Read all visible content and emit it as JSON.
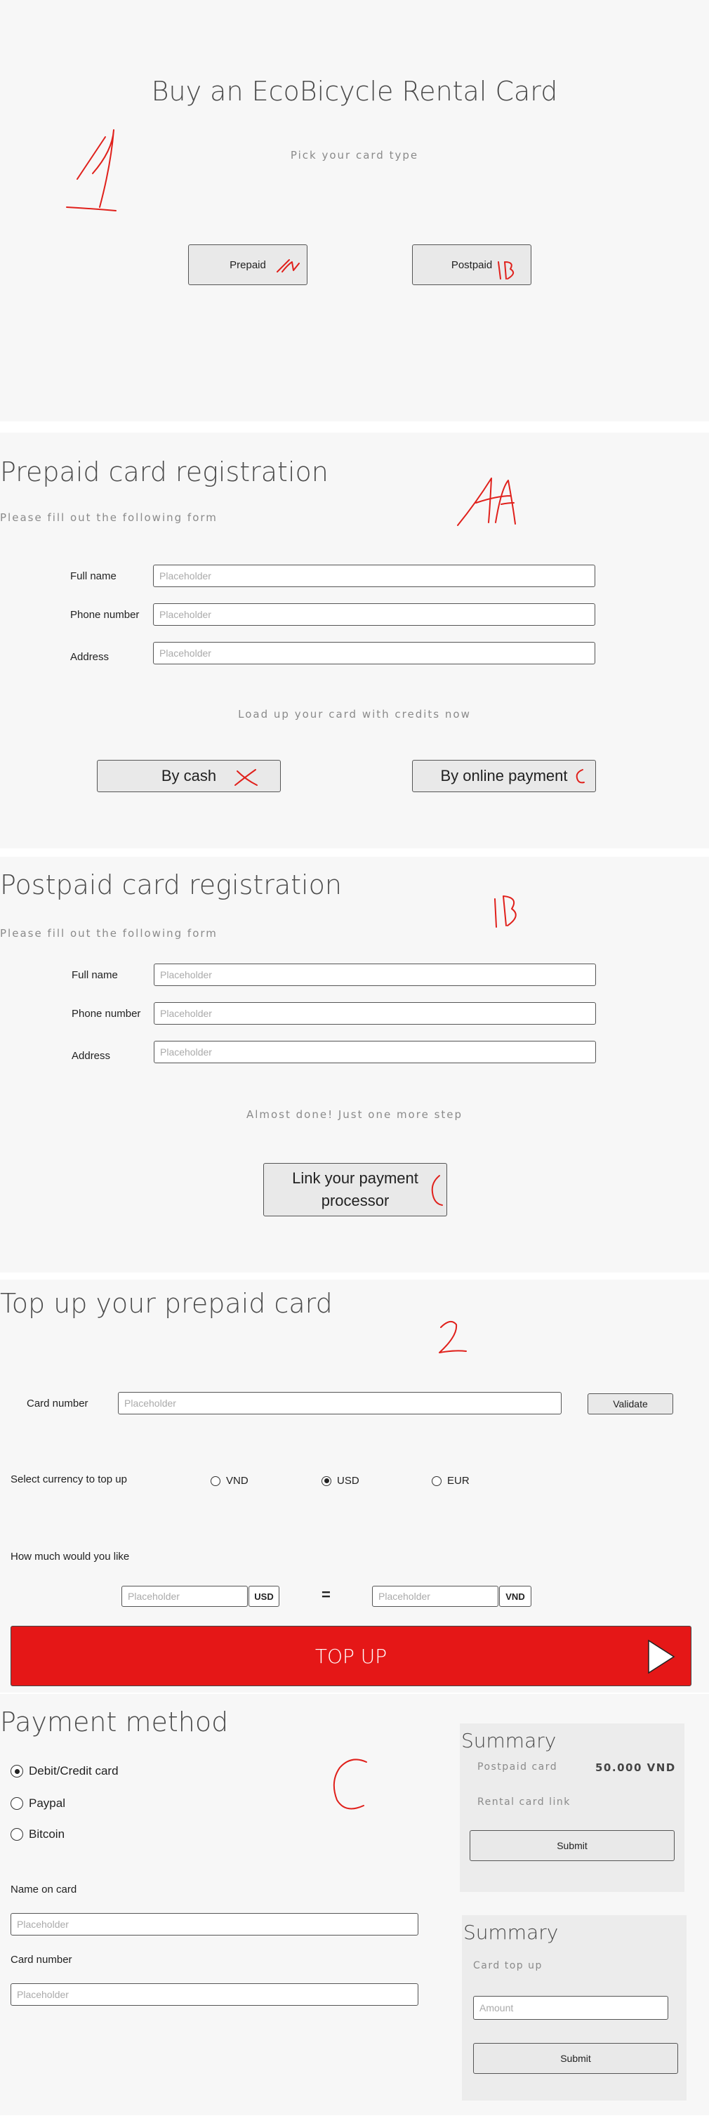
{
  "colors": {
    "panel_bg": "#f7f7f7",
    "accent_red": "#e51717",
    "annotation_red": "#e0201b"
  },
  "pick": {
    "title": "Buy an EcoBicycle Rental Card",
    "subtitle": "Pick your card type",
    "prepaid_label": "Prepaid",
    "postpaid_label": "Postpaid"
  },
  "prepaid": {
    "title": "Prepaid card registration",
    "subtitle": "Please fill out the following form",
    "full_name": "Full name",
    "phone": "Phone number",
    "address": "Address",
    "placeholder": "Placeholder",
    "load_text": "Load up your card with credits now",
    "cash_label": "By cash",
    "online_label": "By online payment"
  },
  "postpaid": {
    "title": "Postpaid card registration",
    "subtitle": "Please fill out the following form",
    "full_name": "Full name",
    "phone": "Phone number",
    "address": "Address",
    "placeholder": "Placeholder",
    "almost_text": "Almost done! Just one more step",
    "link_label_1": "Link your payment",
    "link_label_2": "processor"
  },
  "topup": {
    "title": "Top up your prepaid card",
    "card_number": "Card number",
    "placeholder": "Placeholder",
    "validate": "Validate",
    "currency_label": "Select currency to top up",
    "currencies": [
      {
        "label": "VND",
        "selected": false
      },
      {
        "label": "USD",
        "selected": true
      },
      {
        "label": "EUR",
        "selected": false
      }
    ],
    "amount_label": "How much would you like",
    "from_currency": "USD",
    "equals": "=",
    "to_currency": "VND",
    "button": "TOP UP",
    "play_icon": "play-icon"
  },
  "payment": {
    "title": "Payment method",
    "methods": [
      {
        "label": "Debit/Credit card",
        "selected": true
      },
      {
        "label": "Paypal",
        "selected": false
      },
      {
        "label": "Bitcoin",
        "selected": false
      }
    ],
    "name_on_card": "Name on card",
    "card_number": "Card number",
    "placeholder": "Placeholder"
  },
  "summary1": {
    "title": "Summary",
    "item": "Postpaid card",
    "price": "50.000 VND",
    "link": "Rental card link",
    "submit": "Submit"
  },
  "summary2": {
    "title": "Summary",
    "item": "Card top up",
    "amount_placeholder": "Amount",
    "submit": "Submit"
  }
}
